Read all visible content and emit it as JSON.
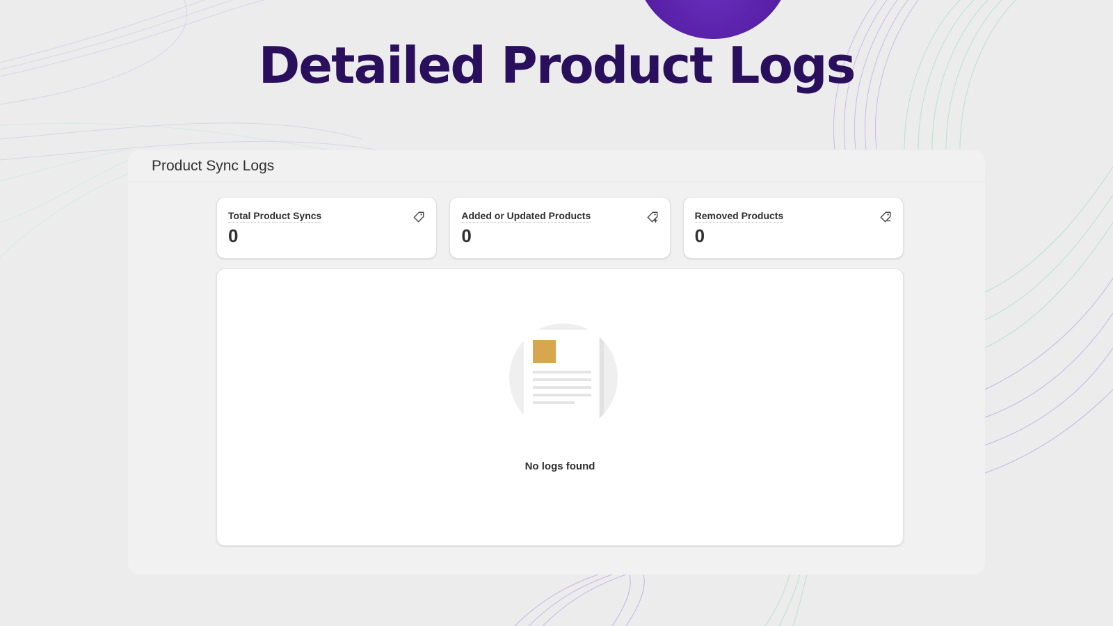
{
  "hero": {
    "title": "Detailed Product Logs"
  },
  "panel": {
    "title": "Product Sync Logs"
  },
  "stats": [
    {
      "label": "Total Product Syncs",
      "value": "0",
      "icon": "tag-icon"
    },
    {
      "label": "Added or Updated Products",
      "value": "0",
      "icon": "tag-add-icon"
    },
    {
      "label": "Removed Products",
      "value": "0",
      "icon": "tag-remove-icon"
    }
  ],
  "logs": {
    "empty_message": "No logs found",
    "illustration": "empty-document-icon"
  },
  "colors": {
    "title": "#2a0f5c",
    "blob": "#5a22a8",
    "card_border": "#e1e1e1",
    "link": "#2c6ecb"
  }
}
